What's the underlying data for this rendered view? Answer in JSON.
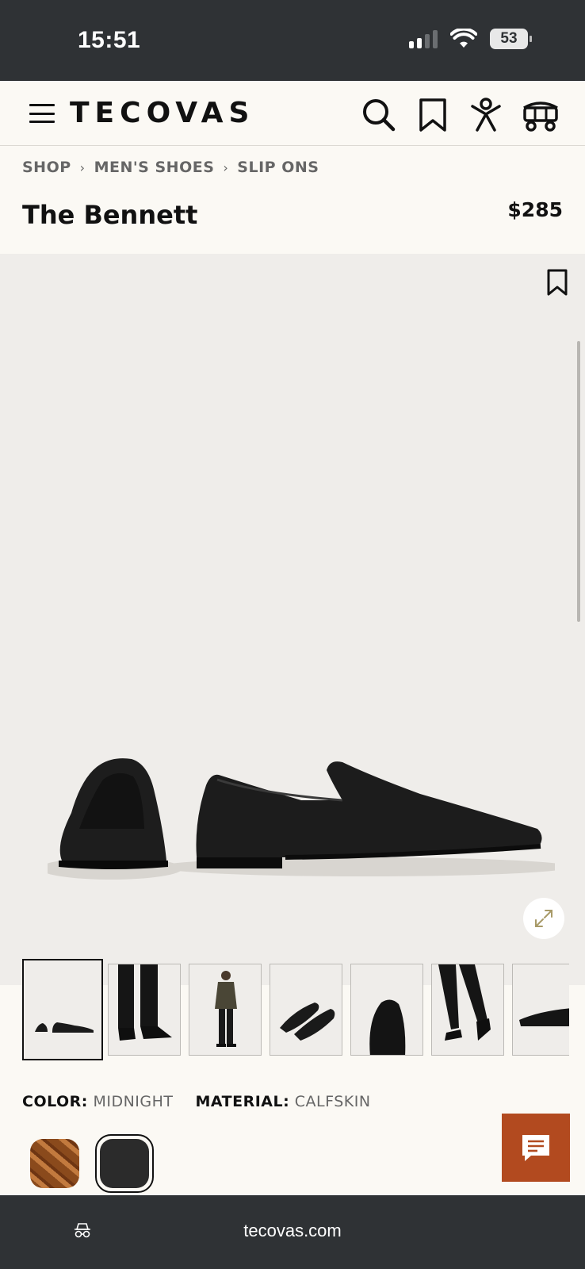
{
  "status_bar": {
    "time": "15:51",
    "battery": "53",
    "icons": [
      "signal-icon",
      "wifi-icon",
      "battery-icon"
    ]
  },
  "header": {
    "logo": "TECOVAS",
    "icons": [
      "menu-icon",
      "search-icon",
      "bookmark-icon",
      "account-icon",
      "cart-wagon-icon"
    ]
  },
  "breadcrumb": {
    "items": [
      "SHOP",
      "MEN'S SHOES",
      "SLIP ONS"
    ],
    "separator_icon": "chevron-right-icon"
  },
  "product": {
    "title": "The Bennett",
    "price": "$285"
  },
  "gallery": {
    "main_image": "black-loafer-pair",
    "thumbnails": [
      {
        "name": "thumbnail-pair-side",
        "selected": true
      },
      {
        "name": "thumbnail-legs-wearing"
      },
      {
        "name": "thumbnail-full-body-model"
      },
      {
        "name": "thumbnail-pair-angle"
      },
      {
        "name": "thumbnail-toe-closeup"
      },
      {
        "name": "thumbnail-walking"
      },
      {
        "name": "thumbnail-heel-detail"
      }
    ],
    "expand_icon": "expand-icon"
  },
  "attributes": {
    "color_label": "COLOR:",
    "color_value": "MIDNIGHT",
    "material_label": "MATERIAL:",
    "material_value": "CALFSKIN"
  },
  "swatches": [
    {
      "name": "croc-brown",
      "selected": false
    },
    {
      "name": "calfskin-midnight",
      "selected": true
    }
  ],
  "chat": {
    "icon": "chat-icon"
  },
  "browser": {
    "url": "tecovas.com",
    "icon": "incognito-icon"
  },
  "colors": {
    "status_bg": "#2f3235",
    "page_bg": "#fbf9f4",
    "hero_bg": "#efedea",
    "chat_accent": "#b24a1f",
    "muted_text": "#666666"
  }
}
